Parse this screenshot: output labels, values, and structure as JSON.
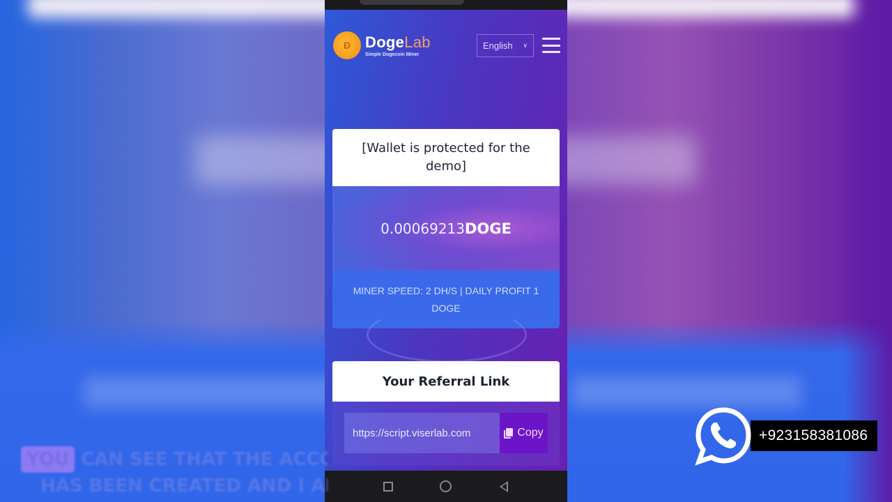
{
  "background": {
    "accent_blue": "#3266ea",
    "accent_purple": "#5e1ba6"
  },
  "app": {
    "brand_name_primary": "Doge",
    "brand_name_accent": "Lab",
    "tagline": "Simple Dogecoin Miner",
    "language": {
      "selected": "English",
      "icon": "chevron-down-icon"
    },
    "menu_icon": "hamburger-menu-icon"
  },
  "wallet": {
    "notice": "[Wallet is protected for the demo]",
    "balance_amount": "0.00069213",
    "balance_unit": "DOGE",
    "miner_info": "MINER SPEED: 2 DH/S | DAILY PROFIT 1 DOGE"
  },
  "referral": {
    "title": "Your Referral Link",
    "link_value": "https://script.viserlab.com",
    "copy_label": "Copy",
    "copy_icon": "copy-icon"
  },
  "android_nav": {
    "recents": "square-icon",
    "home": "circle-icon",
    "back": "triangle-back-icon"
  },
  "overlay": {
    "whatsapp_number": "+923158381086",
    "caption_highlight": "YOU",
    "caption_line1": "CAN SEE THAT THE ACCOUNT",
    "caption_line2": "HAS BEEN CREATED AND I AM"
  }
}
